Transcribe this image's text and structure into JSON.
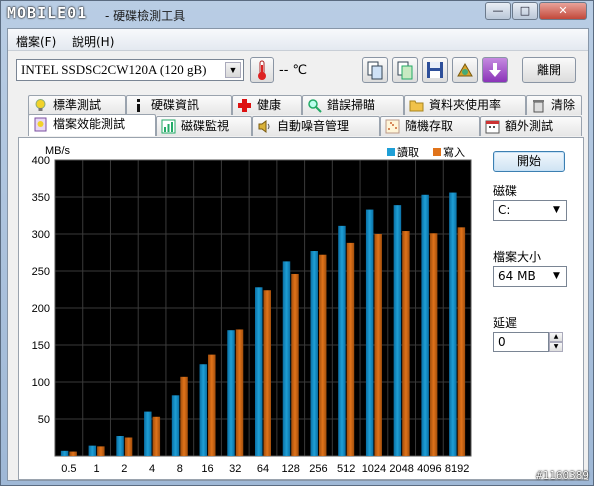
{
  "window": {
    "logo": "MOBILE01",
    "title": "- 硬碟檢測工具",
    "controls": [
      "—",
      "□",
      "✕"
    ]
  },
  "menu": {
    "items": [
      "檔案(F)",
      "說明(H)"
    ]
  },
  "toolbar": {
    "drive": "INTEL SSDSC2CW120A (120 gB)",
    "temperature": "-- ℃",
    "exit_label": "離開"
  },
  "tabs": {
    "row1": [
      "標準測試",
      "硬碟資訊",
      "健康",
      "錯誤掃瞄",
      "資料夾使用率",
      "清除"
    ],
    "row2": [
      "檔案效能測試",
      "磁碟監視",
      "自動噪音管理",
      "隨機存取",
      "額外測試"
    ]
  },
  "side": {
    "start_label": "開始",
    "disk_label": "磁碟",
    "disk_value": "C:",
    "size_label": "檔案大小",
    "size_value": "64 MB",
    "delay_label": "延遲",
    "delay_value": "0"
  },
  "colors": {
    "read": "#1e9fd6",
    "write": "#e0731a",
    "plot_bg": "#000000"
  },
  "chart_data": {
    "type": "bar",
    "ylabel": "MB/s",
    "ylim": [
      0,
      400
    ],
    "yticks": [
      50,
      100,
      150,
      200,
      250,
      300,
      350,
      400
    ],
    "categories": [
      "0.5",
      "1",
      "2",
      "4",
      "8",
      "16",
      "32",
      "64",
      "128",
      "256",
      "512",
      "1024",
      "2048",
      "4096",
      "8192"
    ],
    "series": [
      {
        "name": "讀取",
        "values": [
          7,
          14,
          27,
          60,
          82,
          124,
          170,
          228,
          263,
          277,
          311,
          333,
          339,
          353,
          356
        ]
      },
      {
        "name": "寫入",
        "values": [
          6,
          13,
          25,
          53,
          107,
          137,
          171,
          224,
          246,
          272,
          288,
          300,
          304,
          301,
          309
        ]
      }
    ],
    "legend": "top-right",
    "grid": true
  },
  "watermark": "#1160389"
}
